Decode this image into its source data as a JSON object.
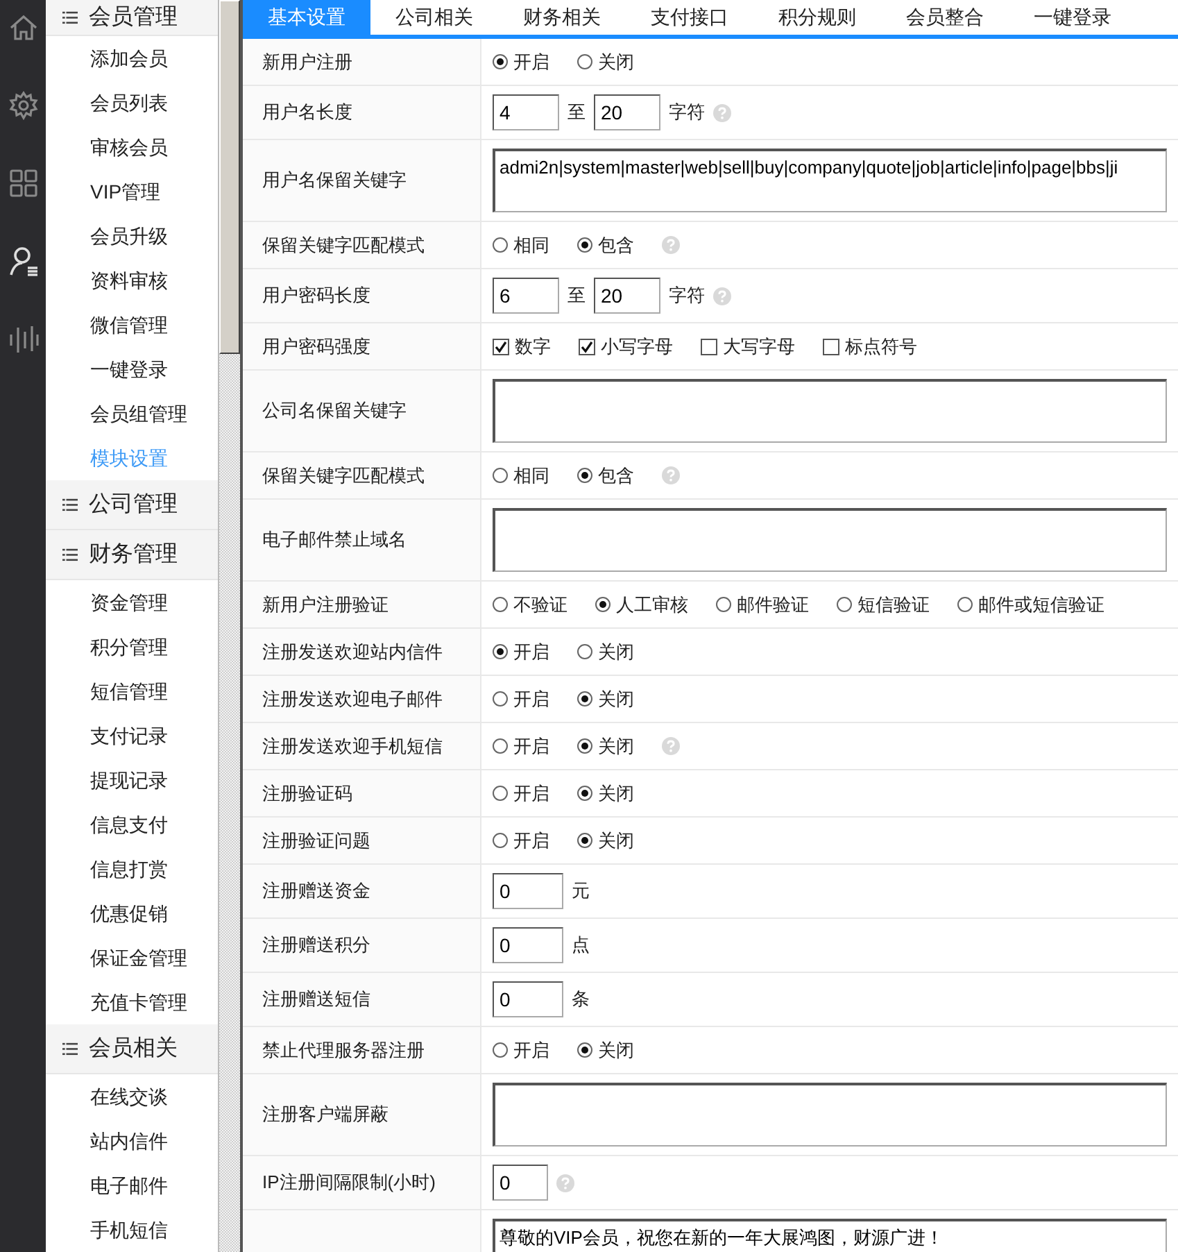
{
  "sidebar": {
    "groups": [
      {
        "title": "会员管理",
        "items": [
          {
            "label": "添加会员",
            "selected": false
          },
          {
            "label": "会员列表",
            "selected": false
          },
          {
            "label": "审核会员",
            "selected": false
          },
          {
            "label": "VIP管理",
            "selected": false
          },
          {
            "label": "会员升级",
            "selected": false
          },
          {
            "label": "资料审核",
            "selected": false
          },
          {
            "label": "微信管理",
            "selected": false
          },
          {
            "label": "一键登录",
            "selected": false
          },
          {
            "label": "会员组管理",
            "selected": false
          },
          {
            "label": "模块设置",
            "selected": true
          }
        ]
      },
      {
        "title": "公司管理"
      },
      {
        "title": "财务管理",
        "items": [
          {
            "label": "资金管理",
            "selected": false
          },
          {
            "label": "积分管理",
            "selected": false
          },
          {
            "label": "短信管理",
            "selected": false
          },
          {
            "label": "支付记录",
            "selected": false
          },
          {
            "label": "提现记录",
            "selected": false
          },
          {
            "label": "信息支付",
            "selected": false
          },
          {
            "label": "信息打赏",
            "selected": false
          },
          {
            "label": "优惠促销",
            "selected": false
          },
          {
            "label": "保证金管理",
            "selected": false
          },
          {
            "label": "充值卡管理",
            "selected": false
          }
        ]
      },
      {
        "title": "会员相关",
        "items": [
          {
            "label": "在线交谈",
            "selected": false
          },
          {
            "label": "站内信件",
            "selected": false
          },
          {
            "label": "电子邮件",
            "selected": false
          },
          {
            "label": "手机短信",
            "selected": false
          }
        ]
      }
    ]
  },
  "tabs": [
    {
      "label": "基本设置",
      "selected": true
    },
    {
      "label": "公司相关",
      "selected": false
    },
    {
      "label": "财务相关",
      "selected": false
    },
    {
      "label": "支付接口",
      "selected": false
    },
    {
      "label": "积分规则",
      "selected": false
    },
    {
      "label": "会员整合",
      "selected": false
    },
    {
      "label": "一键登录",
      "selected": false
    }
  ],
  "form": {
    "rows": [
      {
        "label": "新用户注册",
        "kind": "radio",
        "options": [
          {
            "label": "开启",
            "selected": true
          },
          {
            "label": "关闭",
            "selected": false
          }
        ]
      },
      {
        "label": "用户名长度",
        "kind": "range",
        "from": "4",
        "separator": "至",
        "to": "20",
        "unit": "字符",
        "help": true
      },
      {
        "label": "用户名保留关键字",
        "kind": "textarea",
        "value": "admi2n|system|master|web|sell|buy|company|quote|job|article|info|page|bbs|ji"
      },
      {
        "label": "保留关键字匹配模式",
        "kind": "radio",
        "help": true,
        "options": [
          {
            "label": "相同",
            "selected": false
          },
          {
            "label": "包含",
            "selected": true
          }
        ]
      },
      {
        "label": "用户密码长度",
        "kind": "range",
        "from": "6",
        "separator": "至",
        "to": "20",
        "unit": "字符",
        "help": true
      },
      {
        "label": "用户密码强度",
        "kind": "checkbox",
        "options": [
          {
            "label": "数字",
            "checked": true
          },
          {
            "label": "小写字母",
            "checked": true
          },
          {
            "label": "大写字母",
            "checked": false
          },
          {
            "label": "标点符号",
            "checked": false
          }
        ]
      },
      {
        "label": "公司名保留关键字",
        "kind": "textarea"
      },
      {
        "label": "保留关键字匹配模式",
        "kind": "radio",
        "help": true,
        "options": [
          {
            "label": "相同",
            "selected": false
          },
          {
            "label": "包含",
            "selected": true
          }
        ]
      },
      {
        "label": "电子邮件禁止域名",
        "kind": "textarea"
      },
      {
        "label": "新用户注册验证",
        "kind": "radio",
        "options": [
          {
            "label": "不验证",
            "selected": false
          },
          {
            "label": "人工审核",
            "selected": true
          },
          {
            "label": "邮件验证",
            "selected": false
          },
          {
            "label": "短信验证",
            "selected": false
          },
          {
            "label": "邮件或短信验证",
            "selected": false
          }
        ]
      },
      {
        "label": "注册发送欢迎站内信件",
        "kind": "radio",
        "options": [
          {
            "label": "开启",
            "selected": true
          },
          {
            "label": "关闭",
            "selected": false
          }
        ]
      },
      {
        "label": "注册发送欢迎电子邮件",
        "kind": "radio",
        "options": [
          {
            "label": "开启",
            "selected": false
          },
          {
            "label": "关闭",
            "selected": true
          }
        ]
      },
      {
        "label": "注册发送欢迎手机短信",
        "kind": "radio",
        "help": true,
        "options": [
          {
            "label": "开启",
            "selected": false
          },
          {
            "label": "关闭",
            "selected": true
          }
        ]
      },
      {
        "label": "注册验证码",
        "kind": "radio",
        "options": [
          {
            "label": "开启",
            "selected": false
          },
          {
            "label": "关闭",
            "selected": true
          }
        ]
      },
      {
        "label": "注册验证问题",
        "kind": "radio",
        "options": [
          {
            "label": "开启",
            "selected": false
          },
          {
            "label": "关闭",
            "selected": true
          }
        ]
      },
      {
        "label": "注册赠送资金",
        "kind": "number",
        "value": "0",
        "unit": "元"
      },
      {
        "label": "注册赠送积分",
        "kind": "number",
        "value": "0",
        "unit": "点"
      },
      {
        "label": "注册赠送短信",
        "kind": "number",
        "value": "0",
        "unit": "条"
      },
      {
        "label": "禁止代理服务器注册",
        "kind": "radio",
        "options": [
          {
            "label": "开启",
            "selected": false
          },
          {
            "label": "关闭",
            "selected": true
          }
        ]
      },
      {
        "label": "注册客户端屏蔽",
        "kind": "textarea"
      },
      {
        "label": "IP注册间隔限制(小时)",
        "kind": "number",
        "value": "0",
        "help": true
      },
      {
        "kind": "textarea",
        "value": "尊敬的VIP会员，祝您在新的一年大展鸿图，财源广进！"
      }
    ]
  }
}
